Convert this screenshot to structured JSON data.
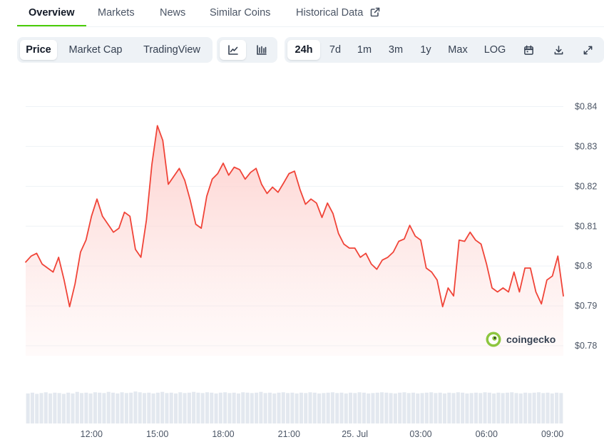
{
  "nav": {
    "tabs": [
      {
        "label": "Overview",
        "active": true
      },
      {
        "label": "Markets"
      },
      {
        "label": "News"
      },
      {
        "label": "Similar Coins"
      },
      {
        "label": "Historical Data",
        "icon": "external-link-icon"
      }
    ]
  },
  "toolbar": {
    "data_tabs": [
      {
        "label": "Price",
        "active": true
      },
      {
        "label": "Market Cap"
      },
      {
        "label": "TradingView"
      }
    ],
    "chart_type_icons": [
      {
        "icon": "line-chart-icon",
        "active": true
      },
      {
        "icon": "candlestick-chart-icon"
      }
    ],
    "ranges": [
      {
        "label": "24h",
        "active": true
      },
      {
        "label": "7d"
      },
      {
        "label": "1m"
      },
      {
        "label": "3m"
      },
      {
        "label": "1y"
      },
      {
        "label": "Max"
      },
      {
        "label": "LOG"
      }
    ],
    "action_icons": [
      "calendar-icon",
      "download-icon",
      "fullscreen-icon"
    ]
  },
  "watermark": {
    "text": "coingecko",
    "icon": "gecko-logo-icon"
  },
  "colors": {
    "accent": "#4bcc00",
    "line": "#f04438",
    "area_top": "#fecdca",
    "volume": "#e3e8ef"
  },
  "chart_data": {
    "type": "area",
    "y_tick_labels": [
      "$0.84",
      "$0.83",
      "$0.82",
      "$0.81",
      "$0.8",
      "$0.79",
      "$0.78"
    ],
    "y_ticks": [
      0.84,
      0.83,
      0.82,
      0.81,
      0.8,
      0.79,
      0.78
    ],
    "ylim": [
      0.7775,
      0.8417
    ],
    "x_tick_labels": [
      "12:00",
      "15:00",
      "18:00",
      "21:00",
      "25. Jul",
      "03:00",
      "06:00",
      "09:00"
    ],
    "x_ticks": [
      3.0,
      6.0,
      9.0,
      12.0,
      15.0,
      18.0,
      21.0,
      24.0
    ],
    "xlim": [
      0.0,
      24.5
    ],
    "grid": true,
    "series": [
      {
        "x": [
          0.0,
          0.25,
          0.5,
          0.75,
          1.0,
          1.25,
          1.5,
          1.75,
          2.0,
          2.25,
          2.5,
          2.75,
          3.0,
          3.25,
          3.5,
          3.75,
          4.0,
          4.25,
          4.5,
          4.75,
          5.0,
          5.25,
          5.5,
          5.75,
          6.0,
          6.25,
          6.5,
          6.75,
          7.0,
          7.25,
          7.5,
          7.75,
          8.0,
          8.25,
          8.5,
          8.75,
          9.0,
          9.25,
          9.5,
          9.75,
          10.0,
          10.25,
          10.5,
          10.75,
          11.0,
          11.25,
          11.5,
          11.75,
          12.0,
          12.25,
          12.5,
          12.75,
          13.0,
          13.25,
          13.5,
          13.75,
          14.0,
          14.25,
          14.5,
          14.75,
          15.0,
          15.25,
          15.5,
          15.75,
          16.0,
          16.25,
          16.5,
          16.75,
          17.0,
          17.25,
          17.5,
          17.75,
          18.0,
          18.25,
          18.5,
          18.75,
          19.0,
          19.25,
          19.5,
          19.75,
          20.0,
          20.25,
          20.5,
          20.75,
          21.0,
          21.25,
          21.5,
          21.75,
          22.0,
          22.25,
          22.5,
          22.75,
          23.0,
          23.25,
          23.5,
          23.75,
          24.0,
          24.25,
          24.5
        ],
        "y": [
          0.801,
          0.8025,
          0.8032,
          0.8005,
          0.7995,
          0.7985,
          0.8022,
          0.7965,
          0.7898,
          0.7955,
          0.8035,
          0.8065,
          0.8125,
          0.8168,
          0.8125,
          0.8105,
          0.8085,
          0.8095,
          0.8135,
          0.8125,
          0.8042,
          0.8022,
          0.8115,
          0.8255,
          0.8352,
          0.8315,
          0.8205,
          0.8225,
          0.8245,
          0.8215,
          0.8165,
          0.8105,
          0.8095,
          0.8175,
          0.8218,
          0.8232,
          0.8258,
          0.8228,
          0.8248,
          0.8242,
          0.8218,
          0.8235,
          0.8245,
          0.8205,
          0.8182,
          0.8198,
          0.8185,
          0.8208,
          0.8232,
          0.8238,
          0.8192,
          0.8155,
          0.8168,
          0.8158,
          0.8122,
          0.8158,
          0.8132,
          0.8082,
          0.8055,
          0.8045,
          0.8045,
          0.8022,
          0.8032,
          0.8005,
          0.7992,
          0.8015,
          0.8022,
          0.8035,
          0.8062,
          0.8068,
          0.8102,
          0.8075,
          0.8065,
          0.7995,
          0.7985,
          0.7965,
          0.7898,
          0.7945,
          0.7925,
          0.8065,
          0.8062,
          0.8085,
          0.8065,
          0.8055,
          0.8005,
          0.7945,
          0.7935,
          0.7945,
          0.7935,
          0.7985,
          0.7935,
          0.7995,
          0.7995,
          0.7935,
          0.7905,
          0.7965,
          0.7975,
          0.8025,
          0.7925
        ]
      }
    ],
    "volume": {
      "count": 120,
      "note_free": true,
      "relative_heights": [
        0.78,
        0.8,
        0.77,
        0.79,
        0.81,
        0.78,
        0.8,
        0.79,
        0.77,
        0.8,
        0.78,
        0.82,
        0.79,
        0.8,
        0.78,
        0.81,
        0.8,
        0.79,
        0.82,
        0.8,
        0.78,
        0.81,
        0.79,
        0.8,
        0.83,
        0.81,
        0.79,
        0.8,
        0.78,
        0.8,
        0.82,
        0.79,
        0.8,
        0.78,
        0.81,
        0.79,
        0.8,
        0.82,
        0.8,
        0.79,
        0.81,
        0.8,
        0.78,
        0.8,
        0.81,
        0.79,
        0.8,
        0.78,
        0.81,
        0.8,
        0.79,
        0.8,
        0.82,
        0.79,
        0.8,
        0.78,
        0.8,
        0.81,
        0.79,
        0.8,
        0.78,
        0.8,
        0.79,
        0.81,
        0.8,
        0.78,
        0.79,
        0.8,
        0.81,
        0.79,
        0.8,
        0.78,
        0.8,
        0.79,
        0.81,
        0.8,
        0.78,
        0.79,
        0.8,
        0.81,
        0.8,
        0.79,
        0.78,
        0.8,
        0.81,
        0.79,
        0.8,
        0.78,
        0.79,
        0.8,
        0.81,
        0.79,
        0.8,
        0.78,
        0.8,
        0.79,
        0.81,
        0.8,
        0.78,
        0.79,
        0.8,
        0.79,
        0.81,
        0.8,
        0.78,
        0.8,
        0.79,
        0.8,
        0.81,
        0.79,
        0.78,
        0.8,
        0.79,
        0.8,
        0.81,
        0.79,
        0.8,
        0.78,
        0.8,
        0.79
      ]
    }
  }
}
